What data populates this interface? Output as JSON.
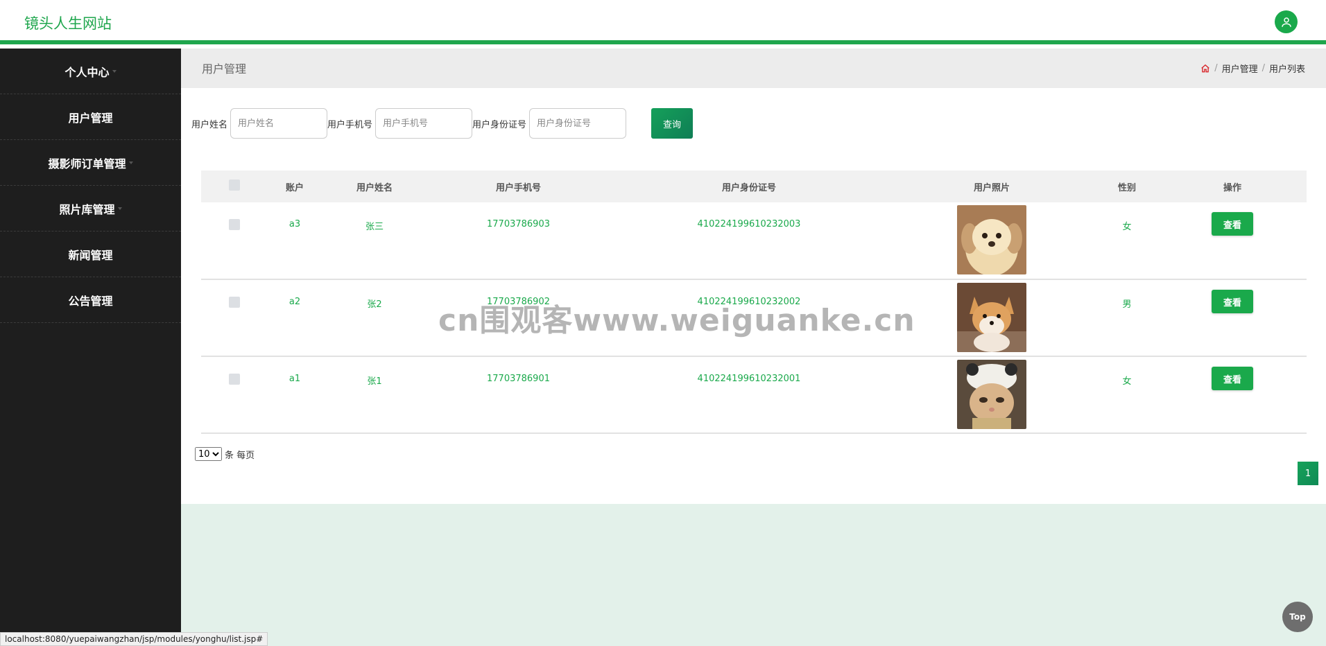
{
  "app": {
    "title": "镜头人生网站"
  },
  "colors": {
    "accent": "#1fa64d",
    "sidebar_bg": "#1e1e1e"
  },
  "sidebar": {
    "items": [
      {
        "label": "个人中心",
        "has_caret": true
      },
      {
        "label": "用户管理",
        "has_caret": false
      },
      {
        "label": "摄影师订单管理",
        "has_caret": true
      },
      {
        "label": "照片库管理",
        "has_caret": true
      },
      {
        "label": "新闻管理",
        "has_caret": false
      },
      {
        "label": "公告管理",
        "has_caret": false
      }
    ]
  },
  "header": {
    "page_title": "用户管理",
    "breadcrumb": [
      "用户管理",
      "用户列表"
    ],
    "home_icon": "home-icon"
  },
  "search": {
    "name_label": "用户姓名",
    "name_placeholder": "用户姓名",
    "phone_label": "用户手机号",
    "phone_placeholder": "用户手机号",
    "id_label": "用户身份证号",
    "id_placeholder": "用户身份证号",
    "button": "查询"
  },
  "table": {
    "columns": [
      "账户",
      "用户姓名",
      "用户手机号",
      "用户身份证号",
      "用户照片",
      "性别",
      "操作"
    ],
    "rows": [
      {
        "account": "a3",
        "name": "张三",
        "phone": "17703786903",
        "id_number": "410224199610232003",
        "photo": "puppy-photo",
        "gender": "女",
        "action": "查看"
      },
      {
        "account": "a2",
        "name": "张2",
        "phone": "17703786902",
        "id_number": "410224199610232002",
        "photo": "shiba-photo",
        "gender": "男",
        "action": "查看"
      },
      {
        "account": "a1",
        "name": "张1",
        "phone": "17703786901",
        "id_number": "410224199610232001",
        "photo": "cat-photo",
        "gender": "女",
        "action": "查看"
      }
    ]
  },
  "pagination": {
    "page_size": "10",
    "page_size_suffix": "条 每页",
    "current_page": "1"
  },
  "watermark": "cn围观客www.weiguanke.cn",
  "top_button": "Top",
  "status_url": "localhost:8080/yuepaiwangzhan/jsp/modules/yonghu/list.jsp#"
}
